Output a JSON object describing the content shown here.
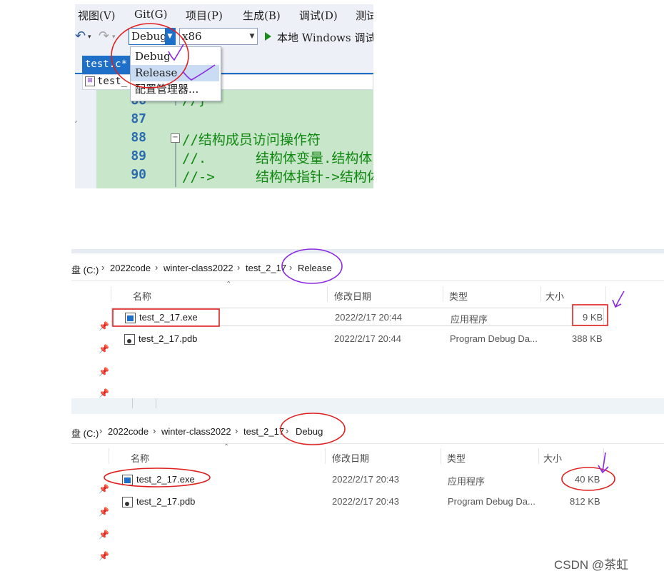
{
  "vs": {
    "menu": [
      "视图(V)",
      "Git(G)",
      "项目(P)",
      "生成(B)",
      "调试(D)",
      "测试"
    ],
    "toolbar": {
      "undo_icon": "undo-icon",
      "redo_icon": "redo-icon",
      "config_value": "Debug",
      "platform_value": "x86",
      "run_label": "本地 Windows 调试"
    },
    "config_dropdown": {
      "options": [
        "Debug",
        "Release",
        "配置管理器..."
      ],
      "highlighted": "Release"
    },
    "tab": {
      "label": "test.c*"
    },
    "navbar": {
      "label": "test_"
    },
    "code_lines": [
      {
        "num": "86",
        "text": "//}"
      },
      {
        "num": "87",
        "text": ""
      },
      {
        "num": "88",
        "text": "//结构成员访问操作符"
      },
      {
        "num": "89",
        "text": "//.      结构体变量.结构体"
      },
      {
        "num": "90",
        "text": "//->     结构体指针->结构体"
      }
    ]
  },
  "explorer_release": {
    "breadcrumb": [
      "盘 (C:)",
      "2022code",
      "winter-class2022",
      "test_2_17",
      "Release"
    ],
    "columns": [
      "名称",
      "修改日期",
      "类型",
      "大小"
    ],
    "rows": [
      {
        "name": "test_2_17.exe",
        "date": "2022/2/17 20:44",
        "type": "应用程序",
        "size": "9 KB",
        "icon": "exe-icon"
      },
      {
        "name": "test_2_17.pdb",
        "date": "2022/2/17 20:44",
        "type": "Program Debug Da...",
        "size": "388 KB",
        "icon": "pdb-icon"
      }
    ]
  },
  "explorer_debug": {
    "breadcrumb": [
      "盘 (C:)",
      "2022code",
      "winter-class2022",
      "test_2_17",
      "Debug"
    ],
    "columns": [
      "名称",
      "修改日期",
      "类型",
      "大小"
    ],
    "rows": [
      {
        "name": "test_2_17.exe",
        "date": "2022/2/17 20:43",
        "type": "应用程序",
        "size": "40 KB",
        "icon": "exe-icon"
      },
      {
        "name": "test_2_17.pdb",
        "date": "2022/2/17 20:43",
        "type": "Program Debug Da...",
        "size": "812 KB",
        "icon": "pdb-icon"
      }
    ]
  },
  "annotation_colors": {
    "red": "#e02020",
    "purple": "#8a2be2"
  },
  "watermark": "CSDN @茶虹"
}
